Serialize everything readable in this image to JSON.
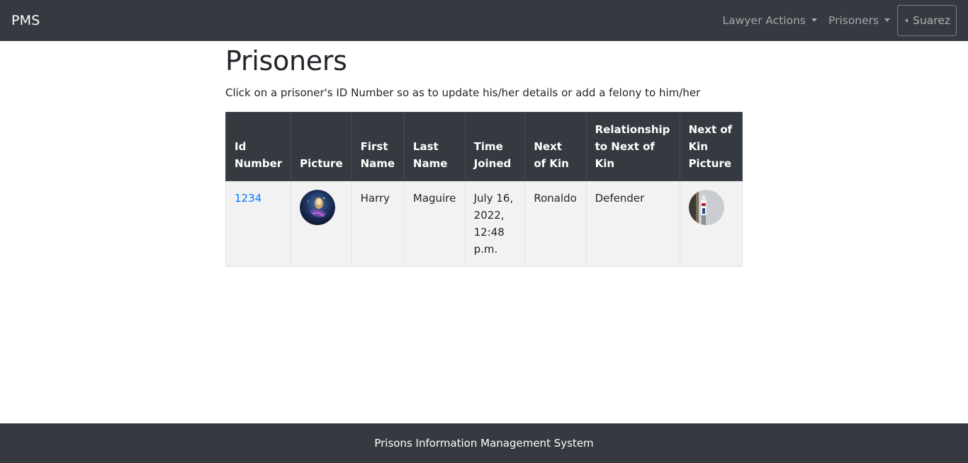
{
  "navbar": {
    "brand": "PMS",
    "menus": [
      {
        "label": "Lawyer Actions"
      },
      {
        "label": "Prisoners"
      }
    ],
    "user": "Suarez"
  },
  "main": {
    "title": "Prisoners",
    "subtitle": "Click on a prisoner's ID Number so as to update his/her details or add a felony to him/her"
  },
  "table": {
    "headers": [
      "Id Number",
      "Picture",
      "First Name",
      "Last Name",
      "Time Joined",
      "Next of Kin",
      "Relationship to Next of Kin",
      "Next of Kin Picture"
    ],
    "rows": [
      {
        "id": "1234",
        "first_name": "Harry",
        "last_name": "Maguire",
        "time_joined": "July 16, 2022, 12:48 p.m.",
        "next_of_kin": "Ronaldo",
        "relationship": "Defender"
      }
    ]
  },
  "footer": {
    "text": "Prisons Information Management System"
  }
}
